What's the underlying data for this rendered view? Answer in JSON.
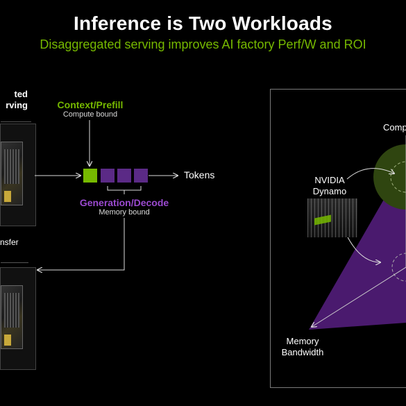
{
  "slide": {
    "title": "Inference is Two Workloads",
    "subtitle": "Disaggregated serving improves AI factory Perf/W and ROI"
  },
  "left": {
    "heading_line1": "ted",
    "heading_line2": "rving",
    "transfer_label": "nsfer"
  },
  "pipeline": {
    "context_title": "Context/Prefill",
    "context_sub": "Compute bound",
    "generation_title": "Generation/Decode",
    "generation_sub": "Memory bound",
    "tokens_label": "Tokens"
  },
  "right": {
    "compute_label": "Comp",
    "dynamo_line1": "NVIDIA",
    "dynamo_line2": "Dynamo",
    "memory_line1": "Memory",
    "memory_line2": "Bandwidth"
  },
  "colors": {
    "accent_green": "#76b900",
    "accent_purple": "#5b2a86",
    "purple_text": "#9b4ad0"
  }
}
